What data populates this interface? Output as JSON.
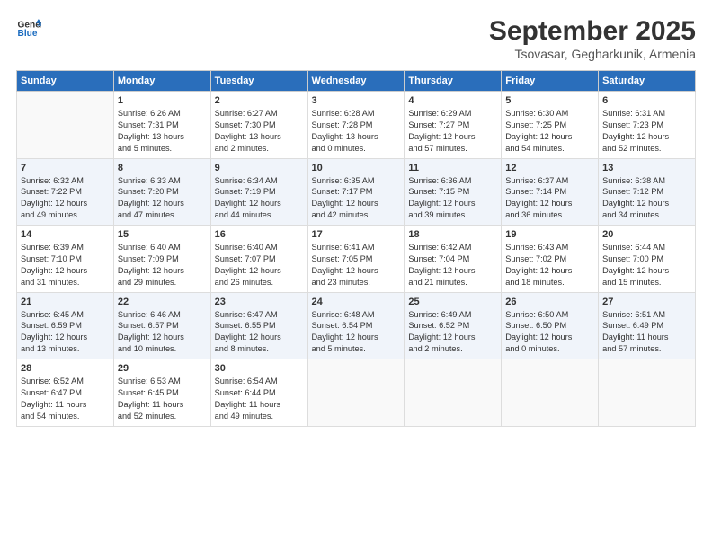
{
  "header": {
    "logo_line1": "General",
    "logo_line2": "Blue",
    "month": "September 2025",
    "location": "Tsovasar, Gegharkunik, Armenia"
  },
  "weekdays": [
    "Sunday",
    "Monday",
    "Tuesday",
    "Wednesday",
    "Thursday",
    "Friday",
    "Saturday"
  ],
  "weeks": [
    [
      {
        "day": "",
        "info": ""
      },
      {
        "day": "1",
        "info": "Sunrise: 6:26 AM\nSunset: 7:31 PM\nDaylight: 13 hours\nand 5 minutes."
      },
      {
        "day": "2",
        "info": "Sunrise: 6:27 AM\nSunset: 7:30 PM\nDaylight: 13 hours\nand 2 minutes."
      },
      {
        "day": "3",
        "info": "Sunrise: 6:28 AM\nSunset: 7:28 PM\nDaylight: 13 hours\nand 0 minutes."
      },
      {
        "day": "4",
        "info": "Sunrise: 6:29 AM\nSunset: 7:27 PM\nDaylight: 12 hours\nand 57 minutes."
      },
      {
        "day": "5",
        "info": "Sunrise: 6:30 AM\nSunset: 7:25 PM\nDaylight: 12 hours\nand 54 minutes."
      },
      {
        "day": "6",
        "info": "Sunrise: 6:31 AM\nSunset: 7:23 PM\nDaylight: 12 hours\nand 52 minutes."
      }
    ],
    [
      {
        "day": "7",
        "info": "Sunrise: 6:32 AM\nSunset: 7:22 PM\nDaylight: 12 hours\nand 49 minutes."
      },
      {
        "day": "8",
        "info": "Sunrise: 6:33 AM\nSunset: 7:20 PM\nDaylight: 12 hours\nand 47 minutes."
      },
      {
        "day": "9",
        "info": "Sunrise: 6:34 AM\nSunset: 7:19 PM\nDaylight: 12 hours\nand 44 minutes."
      },
      {
        "day": "10",
        "info": "Sunrise: 6:35 AM\nSunset: 7:17 PM\nDaylight: 12 hours\nand 42 minutes."
      },
      {
        "day": "11",
        "info": "Sunrise: 6:36 AM\nSunset: 7:15 PM\nDaylight: 12 hours\nand 39 minutes."
      },
      {
        "day": "12",
        "info": "Sunrise: 6:37 AM\nSunset: 7:14 PM\nDaylight: 12 hours\nand 36 minutes."
      },
      {
        "day": "13",
        "info": "Sunrise: 6:38 AM\nSunset: 7:12 PM\nDaylight: 12 hours\nand 34 minutes."
      }
    ],
    [
      {
        "day": "14",
        "info": "Sunrise: 6:39 AM\nSunset: 7:10 PM\nDaylight: 12 hours\nand 31 minutes."
      },
      {
        "day": "15",
        "info": "Sunrise: 6:40 AM\nSunset: 7:09 PM\nDaylight: 12 hours\nand 29 minutes."
      },
      {
        "day": "16",
        "info": "Sunrise: 6:40 AM\nSunset: 7:07 PM\nDaylight: 12 hours\nand 26 minutes."
      },
      {
        "day": "17",
        "info": "Sunrise: 6:41 AM\nSunset: 7:05 PM\nDaylight: 12 hours\nand 23 minutes."
      },
      {
        "day": "18",
        "info": "Sunrise: 6:42 AM\nSunset: 7:04 PM\nDaylight: 12 hours\nand 21 minutes."
      },
      {
        "day": "19",
        "info": "Sunrise: 6:43 AM\nSunset: 7:02 PM\nDaylight: 12 hours\nand 18 minutes."
      },
      {
        "day": "20",
        "info": "Sunrise: 6:44 AM\nSunset: 7:00 PM\nDaylight: 12 hours\nand 15 minutes."
      }
    ],
    [
      {
        "day": "21",
        "info": "Sunrise: 6:45 AM\nSunset: 6:59 PM\nDaylight: 12 hours\nand 13 minutes."
      },
      {
        "day": "22",
        "info": "Sunrise: 6:46 AM\nSunset: 6:57 PM\nDaylight: 12 hours\nand 10 minutes."
      },
      {
        "day": "23",
        "info": "Sunrise: 6:47 AM\nSunset: 6:55 PM\nDaylight: 12 hours\nand 8 minutes."
      },
      {
        "day": "24",
        "info": "Sunrise: 6:48 AM\nSunset: 6:54 PM\nDaylight: 12 hours\nand 5 minutes."
      },
      {
        "day": "25",
        "info": "Sunrise: 6:49 AM\nSunset: 6:52 PM\nDaylight: 12 hours\nand 2 minutes."
      },
      {
        "day": "26",
        "info": "Sunrise: 6:50 AM\nSunset: 6:50 PM\nDaylight: 12 hours\nand 0 minutes."
      },
      {
        "day": "27",
        "info": "Sunrise: 6:51 AM\nSunset: 6:49 PM\nDaylight: 11 hours\nand 57 minutes."
      }
    ],
    [
      {
        "day": "28",
        "info": "Sunrise: 6:52 AM\nSunset: 6:47 PM\nDaylight: 11 hours\nand 54 minutes."
      },
      {
        "day": "29",
        "info": "Sunrise: 6:53 AM\nSunset: 6:45 PM\nDaylight: 11 hours\nand 52 minutes."
      },
      {
        "day": "30",
        "info": "Sunrise: 6:54 AM\nSunset: 6:44 PM\nDaylight: 11 hours\nand 49 minutes."
      },
      {
        "day": "",
        "info": ""
      },
      {
        "day": "",
        "info": ""
      },
      {
        "day": "",
        "info": ""
      },
      {
        "day": "",
        "info": ""
      }
    ]
  ]
}
